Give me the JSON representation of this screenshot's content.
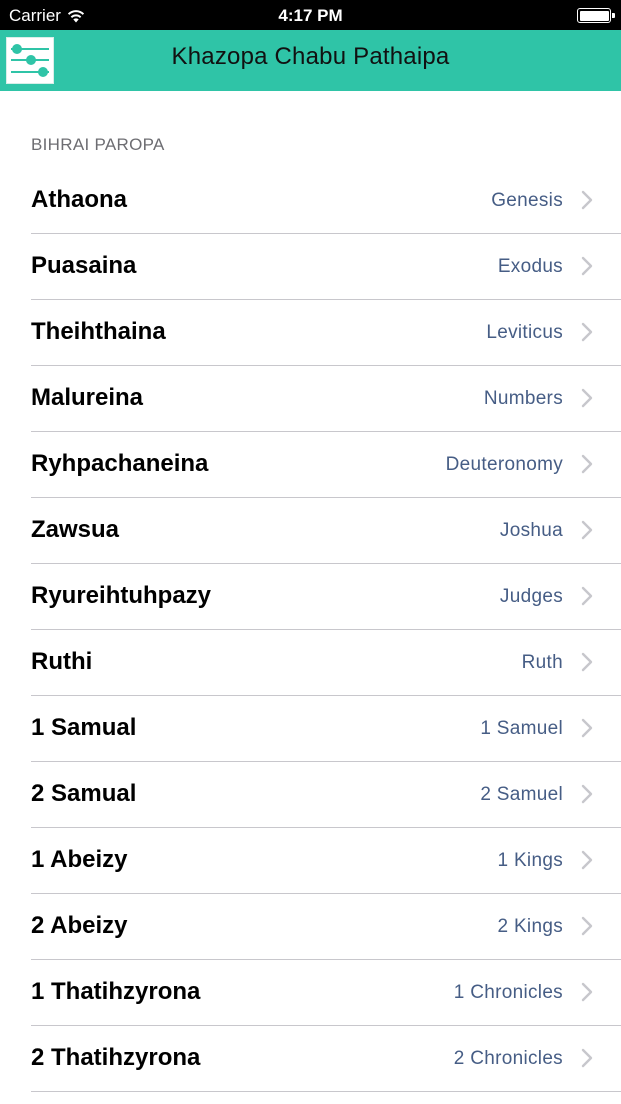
{
  "status_bar": {
    "carrier": "Carrier",
    "time": "4:17 PM",
    "wifi_icon": "wifi-icon",
    "battery_icon": "battery-icon"
  },
  "nav": {
    "title": "Khazopa Chabu Pathaipa",
    "menu_icon": "sliders-icon",
    "accent_color": "#2fc4a7"
  },
  "section": {
    "header": "BIHRAI PAROPA"
  },
  "books": [
    {
      "title": "Athaona",
      "detail": "Genesis"
    },
    {
      "title": "Puasaina",
      "detail": "Exodus"
    },
    {
      "title": "Theihthaina",
      "detail": "Leviticus"
    },
    {
      "title": "Malureina",
      "detail": "Numbers"
    },
    {
      "title": "Ryhpachaneina",
      "detail": "Deuteronomy"
    },
    {
      "title": "Zawsua",
      "detail": "Joshua"
    },
    {
      "title": "Ryureihtuhpazy",
      "detail": "Judges"
    },
    {
      "title": "Ruthi",
      "detail": "Ruth"
    },
    {
      "title": "1 Samual",
      "detail": "1 Samuel"
    },
    {
      "title": "2 Samual",
      "detail": "2 Samuel"
    },
    {
      "title": "1 Abeizy",
      "detail": "1 Kings"
    },
    {
      "title": "2 Abeizy",
      "detail": "2 Kings"
    },
    {
      "title": "1 Thatihzyrona",
      "detail": "1 Chronicles"
    },
    {
      "title": "2 Thatihzyrona",
      "detail": "2 Chronicles"
    }
  ]
}
